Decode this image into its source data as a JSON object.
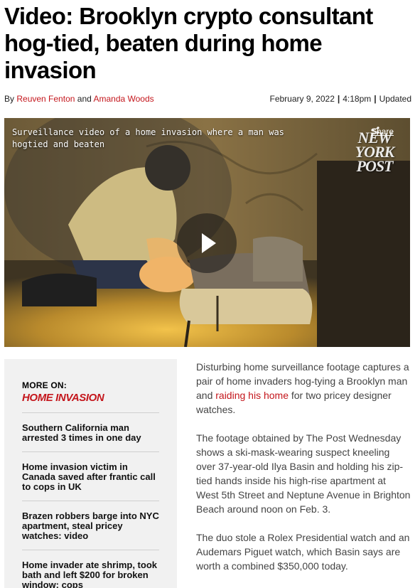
{
  "headline": "Video: Brooklyn crypto consultant hog-tied, beaten during home invasion",
  "byline": {
    "prefix": "By",
    "author1": "Reuven Fenton",
    "conj": "and",
    "author2": "Amanda Woods",
    "date": "February 9, 2022",
    "time": "4:18pm",
    "updated": "Updated"
  },
  "video": {
    "caption": "Surveillance video of a home invasion where a man was hogtied and beaten",
    "share": "Share",
    "logo_line1": "NEW",
    "logo_line2": "YORK",
    "logo_line3": "POST"
  },
  "sidebar": {
    "label": "MORE ON:",
    "topic": "HOME INVASION",
    "items": [
      "Southern California man arrested 3 times in one day",
      "Home invasion victim in Canada saved after frantic call to cops in UK",
      "Brazen robbers barge into NYC apartment, steal pricey watches: video",
      "Home invader ate shrimp, took bath and left $200 for broken window: cops"
    ]
  },
  "article": {
    "p1_a": "Disturbing home surveillance footage captures a pair of home invaders hog-tying a Brooklyn man and ",
    "p1_link": "raiding his home",
    "p1_b": " for two pricey designer watches.",
    "p2": "The footage obtained by The Post Wednesday shows a ski-mask-wearing suspect kneeling over 37-year-old Ilya Basin and holding his zip-tied hands inside his high-rise apartment at West 5th Street and Neptune Avenue in Brighton Beach around noon on Feb. 3.",
    "p3": "The duo stole a Rolex Presidential watch and an Audemars Piguet watch, which Basin says are worth a combined $350,000 today."
  },
  "colors": {
    "accent": "#c4161c",
    "sidebar_bg": "#f1f1f1"
  }
}
